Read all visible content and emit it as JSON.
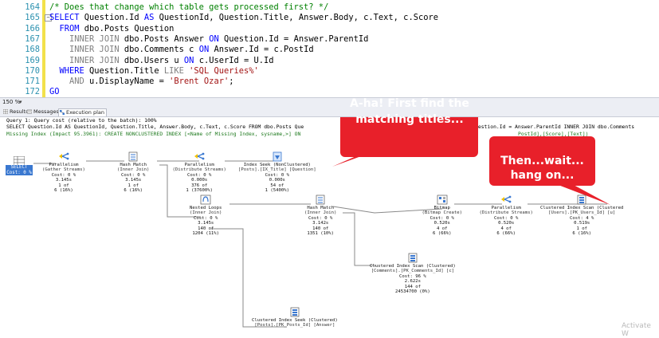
{
  "editor": {
    "lines": [
      {
        "num": "164",
        "parts": [
          {
            "t": "/* Does that change which table gets processed first? */",
            "c": "cm"
          }
        ]
      },
      {
        "num": "165",
        "parts": [
          {
            "t": "SELECT ",
            "c": "kw"
          },
          {
            "t": "Question.Id ",
            "c": ""
          },
          {
            "t": "AS ",
            "c": "kw"
          },
          {
            "t": "QuestionId, Question.Title, Answer.Body, c.Text, c.Score",
            "c": ""
          }
        ]
      },
      {
        "num": "166",
        "parts": [
          {
            "t": "  FROM ",
            "c": "kw"
          },
          {
            "t": "dbo.Posts Question",
            "c": ""
          }
        ]
      },
      {
        "num": "167",
        "parts": [
          {
            "t": "    INNER JOIN ",
            "c": "gray"
          },
          {
            "t": "dbo.Posts Answer ",
            "c": ""
          },
          {
            "t": "ON ",
            "c": "kw"
          },
          {
            "t": "Question.Id = Answer.ParentId",
            "c": ""
          }
        ]
      },
      {
        "num": "168",
        "parts": [
          {
            "t": "    INNER JOIN ",
            "c": "gray"
          },
          {
            "t": "dbo.Comments c ",
            "c": ""
          },
          {
            "t": "ON ",
            "c": "kw"
          },
          {
            "t": "Answer.Id = c.PostId",
            "c": ""
          }
        ]
      },
      {
        "num": "169",
        "parts": [
          {
            "t": "    INNER JOIN ",
            "c": "gray"
          },
          {
            "t": "dbo.Users u ",
            "c": ""
          },
          {
            "t": "ON ",
            "c": "kw"
          },
          {
            "t": "c.UserId = U.Id",
            "c": ""
          }
        ]
      },
      {
        "num": "170",
        "parts": [
          {
            "t": "  WHERE ",
            "c": "kw"
          },
          {
            "t": "Question.Title ",
            "c": ""
          },
          {
            "t": "LIKE ",
            "c": "gray"
          },
          {
            "t": "'SQL Queries%'",
            "c": "str"
          }
        ]
      },
      {
        "num": "171",
        "parts": [
          {
            "t": "    AND ",
            "c": "gray"
          },
          {
            "t": "u.DisplayName = ",
            "c": ""
          },
          {
            "t": "'Brent Ozar'",
            "c": "str"
          },
          {
            "t": ";",
            "c": ""
          }
        ]
      },
      {
        "num": "172",
        "parts": [
          {
            "t": "GO",
            "c": "kw"
          }
        ]
      }
    ]
  },
  "zoom": {
    "value": "150 %"
  },
  "tabs": [
    {
      "label": "Results",
      "icon": "grid-icon"
    },
    {
      "label": "Messages",
      "icon": "message-icon"
    },
    {
      "label": "Execution plan",
      "icon": "plan-icon"
    }
  ],
  "plan": {
    "query_lines": [
      {
        "text": "Query 1: Query cost (relative to the batch): 100%",
        "color": "#000000"
      },
      {
        "text": "SELECT Question.Id AS QuestionId, Question.Title, Answer.Body, c.Text, c.Score FROM dbo.Posts Que",
        "color": "#000000"
      },
      {
        "text": "Missing Index (Impact 95.3961): CREATE NONCLUSTERED INDEX [<Name of Missing Index, sysname,>] ON",
        "color": "#1f7a1f"
      }
    ],
    "query_line_tails": [
      {
        "text": "uestion.Id = Answer.ParentId INNER JOIN dbo.Comments",
        "color": "#000000"
      },
      {
        "text": "PostId],[Score],[Text])",
        "color": "#1f7a1f"
      }
    ],
    "select_node": {
      "line1": "SELECT",
      "line2": "Cost: 0 %"
    },
    "nodes": [
      {
        "id": "par1",
        "lines": [
          "Parallelism",
          "(Gather Streams)",
          "Cost: 0 %",
          "3.145s",
          "1 of",
          "6 (16%)"
        ]
      },
      {
        "id": "hash1",
        "lines": [
          "Hash Match",
          "(Inner Join)",
          "Cost: 0 %",
          "3.145s",
          "1 of",
          "6 (16%)"
        ]
      },
      {
        "id": "par2",
        "lines": [
          "Parallelism",
          "(Distribute Streams)",
          "Cost: 0 %",
          "0.000s",
          "376 of",
          "1 (37600%)"
        ]
      },
      {
        "id": "seek1",
        "lines": [
          "Index Seek (NonClustered)",
          "[Posts].[IX_Title] [Question]",
          "Cost: 0 %",
          "0.000s",
          "54 of",
          "1 (5400%)"
        ]
      },
      {
        "id": "loops",
        "lines": [
          "Nested Loops",
          "(Inner Join)",
          "Cost: 0 %",
          "3.145s",
          "140 of",
          "1204 (11%)"
        ]
      },
      {
        "id": "hash2",
        "lines": [
          "Hash Match",
          "(Inner Join)",
          "Cost: 0 %",
          "3.142s",
          "140 of",
          "1351 (10%)"
        ]
      },
      {
        "id": "bitmap",
        "lines": [
          "Bitmap",
          "(Bitmap Create)",
          "Cost: 0 %",
          "0.520s",
          "4 of",
          "6 (66%)"
        ]
      },
      {
        "id": "par3",
        "lines": [
          "Parallelism",
          "(Distribute Streams)",
          "Cost: 0 %",
          "0.520s",
          "4 of",
          "6 (66%)"
        ]
      },
      {
        "id": "scan1",
        "lines": [
          "Clustered Index Scan (Clustered",
          "[Users].[PK_Users_Id] [u]",
          "Cost: 4 %",
          "0.519s",
          "1 of",
          "6 (16%)"
        ]
      },
      {
        "id": "scan2",
        "lines": [
          "Clustered Index Scan (Clustered)",
          "[Comments].[PK_Comments_Id] [c]",
          "Cost: 96 %",
          "2.622s",
          "144 of",
          "24534700 (0%)"
        ]
      },
      {
        "id": "seek2",
        "lines": [
          "Clustered Index Seek (Clustered)",
          "[Posts].[PK_Posts_Id] [Answer]"
        ]
      }
    ]
  },
  "callouts": {
    "first": {
      "line1": "A-ha! First find the",
      "line2": "matching titles...",
      "color": "#e8202a"
    },
    "second": {
      "line1": "Then...wait...",
      "line2": "hang on...",
      "color": "#e8202a"
    }
  },
  "watermark": "Activate W"
}
